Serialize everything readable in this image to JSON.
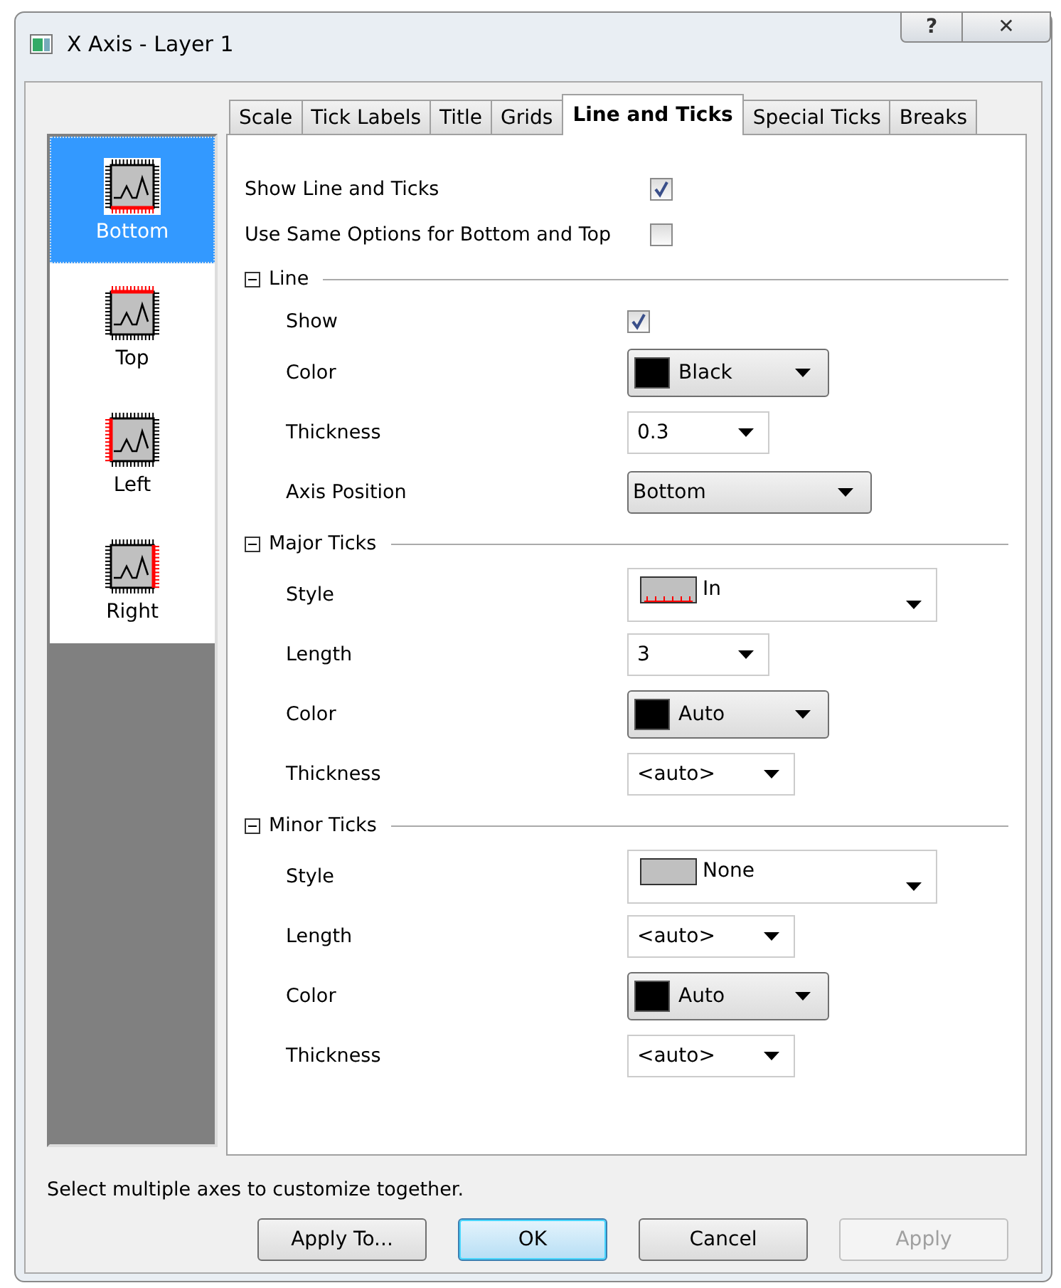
{
  "window": {
    "title": "X Axis - Layer 1",
    "help": "?",
    "close": "✕"
  },
  "axes": [
    {
      "label": "Bottom",
      "kind": "bottom",
      "selected": true
    },
    {
      "label": "Top",
      "kind": "top",
      "selected": false
    },
    {
      "label": "Left",
      "kind": "left",
      "selected": false
    },
    {
      "label": "Right",
      "kind": "right",
      "selected": false
    }
  ],
  "tabs": [
    {
      "label": "Scale",
      "selected": false
    },
    {
      "label": "Tick Labels",
      "selected": false
    },
    {
      "label": "Title",
      "selected": false
    },
    {
      "label": "Grids",
      "selected": false
    },
    {
      "label": "Line and Ticks",
      "selected": true
    },
    {
      "label": "Special Ticks",
      "selected": false
    },
    {
      "label": "Breaks",
      "selected": false
    }
  ],
  "options": [
    {
      "label": "Show Line and Ticks",
      "checked": true
    },
    {
      "label": "Use Same Options for Bottom and Top",
      "checked": false
    }
  ],
  "groups": [
    {
      "title": "Line",
      "expanded": true,
      "rows": [
        {
          "label": "Show",
          "kind": "checkbox",
          "checked": true
        },
        {
          "label": "Color",
          "kind": "color",
          "value": "Black",
          "color": "#000000"
        },
        {
          "label": "Thickness",
          "kind": "combo",
          "value": "0.3"
        },
        {
          "label": "Axis Position",
          "kind": "dropdown",
          "value": "Bottom"
        }
      ]
    },
    {
      "title": "Major Ticks",
      "expanded": true,
      "rows": [
        {
          "label": "Style",
          "kind": "style",
          "value": "In"
        },
        {
          "label": "Length",
          "kind": "combo",
          "value": "3"
        },
        {
          "label": "Color",
          "kind": "color",
          "value": "Auto",
          "color": "#000000"
        },
        {
          "label": "Thickness",
          "kind": "combo",
          "value": "<auto>"
        }
      ]
    },
    {
      "title": "Minor Ticks",
      "expanded": true,
      "rows": [
        {
          "label": "Style",
          "kind": "style",
          "value": "None"
        },
        {
          "label": "Length",
          "kind": "combo",
          "value": "<auto>"
        },
        {
          "label": "Color",
          "kind": "color",
          "value": "Auto",
          "color": "#000000"
        },
        {
          "label": "Thickness",
          "kind": "combo",
          "value": "<auto>"
        }
      ]
    }
  ],
  "hint": "Select multiple axes to customize together.",
  "buttons": [
    {
      "label": "Apply To...",
      "default": false,
      "disabled": false
    },
    {
      "label": "OK",
      "default": true,
      "disabled": false
    },
    {
      "label": "Cancel",
      "default": false,
      "disabled": false
    },
    {
      "label": "Apply",
      "default": false,
      "disabled": true
    }
  ]
}
